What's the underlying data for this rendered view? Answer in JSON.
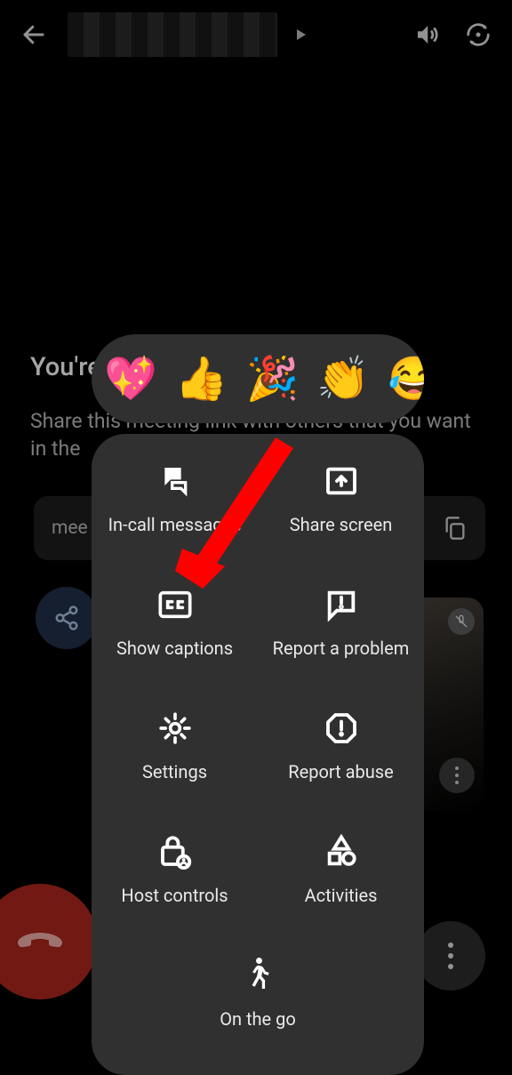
{
  "top_bar": {},
  "background": {
    "title": "You're",
    "subtitle": "Share this meeting link with others that you want in the",
    "meeting_link_prefix": "mee"
  },
  "emoji_reactions": {
    "items": [
      "💖",
      "👍",
      "🎉",
      "👏",
      "😂"
    ]
  },
  "action_sheet": {
    "items": [
      {
        "name": "in-call-messages",
        "label": "In-call messages"
      },
      {
        "name": "share-screen",
        "label": "Share screen"
      },
      {
        "name": "show-captions",
        "label": "Show captions"
      },
      {
        "name": "report-problem",
        "label": "Report a problem"
      },
      {
        "name": "settings",
        "label": "Settings"
      },
      {
        "name": "report-abuse",
        "label": "Report abuse"
      },
      {
        "name": "host-controls",
        "label": "Host controls"
      },
      {
        "name": "activities",
        "label": "Activities"
      },
      {
        "name": "on-the-go",
        "label": "On the go"
      }
    ]
  },
  "annotation": {
    "arrow_color": "#ff0000"
  }
}
